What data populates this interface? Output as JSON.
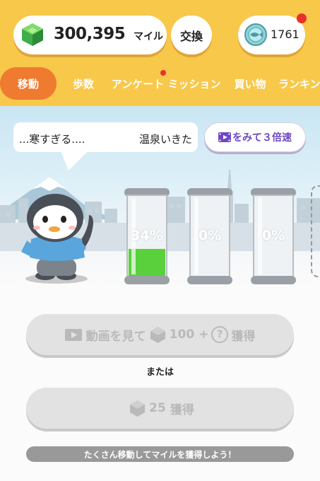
{
  "header": {
    "miles_value": "300,395",
    "miles_unit": "マイル",
    "exchange_label": "交換",
    "coin_value": "1761",
    "icons": {
      "miles": "green-gem-icon",
      "coins": "fish-coin-icon"
    },
    "colors": {
      "background": "#f8c84a",
      "notification": "#e8312d"
    }
  },
  "tabs": [
    {
      "label": "移動",
      "active": true
    },
    {
      "label": "歩数",
      "active": false
    },
    {
      "label": "アンケート",
      "active": false,
      "badge": true
    },
    {
      "label": "ミッション",
      "active": false
    },
    {
      "label": "買い物",
      "active": false
    },
    {
      "label": "ランキング",
      "active": false
    }
  ],
  "scene": {
    "speech": [
      "...寒すぎる....",
      "温泉いきた"
    ],
    "triple_speed_label": "をみて３倍速",
    "tanks": [
      {
        "label": "34%",
        "fill": 0.34
      },
      {
        "label": "0%",
        "fill": 0
      },
      {
        "label": "0%",
        "fill": 0
      }
    ]
  },
  "actions": {
    "watch_video": {
      "prefix": "動画を見て",
      "amount": "100 +",
      "question": "?",
      "suffix": "獲得",
      "enabled": false
    },
    "or_text": "または",
    "claim": {
      "amount": "25",
      "suffix": "獲得",
      "enabled": false
    },
    "hint": "たくさん移動してマイルを獲得しよう！"
  },
  "colors": {
    "accent": "#ee7b30",
    "purple": "#6d48c3",
    "liquid": "#5ad03c"
  }
}
